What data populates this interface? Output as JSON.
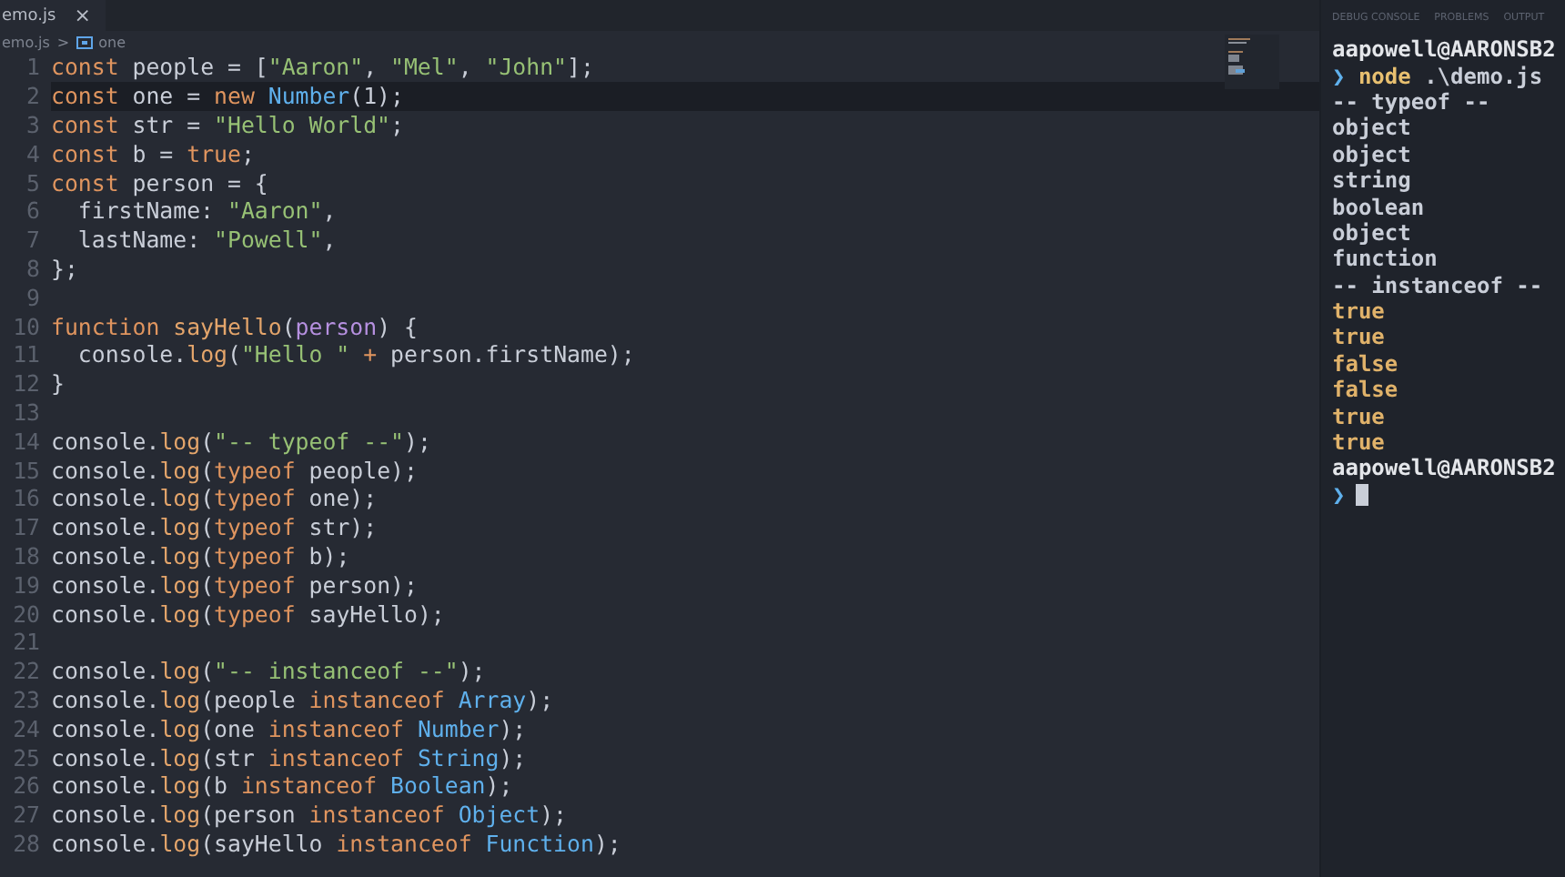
{
  "editor": {
    "tab": {
      "label": "emo.js",
      "close": "×"
    },
    "breadcrumb": {
      "file": "emo.js",
      "separator": ">",
      "symbol": "one"
    },
    "lines": [
      {
        "number": "1",
        "selected": false,
        "tokens": [
          {
            "kind": "keyword",
            "text": "const "
          },
          {
            "kind": "plain",
            "text": "people = ["
          },
          {
            "kind": "string",
            "text": "\"Aaron\""
          },
          {
            "kind": "plain",
            "text": ", "
          },
          {
            "kind": "string",
            "text": "\"Mel\""
          },
          {
            "kind": "plain",
            "text": ", "
          },
          {
            "kind": "string",
            "text": "\"John\""
          },
          {
            "kind": "plain",
            "text": "];"
          }
        ]
      },
      {
        "number": "2",
        "selected": true,
        "tokens": [
          {
            "kind": "keyword",
            "text": "const "
          },
          {
            "kind": "plain",
            "text": "one = "
          },
          {
            "kind": "keyword",
            "text": "new "
          },
          {
            "kind": "type",
            "text": "Number"
          },
          {
            "kind": "plain",
            "text": "(1);"
          }
        ]
      },
      {
        "number": "3",
        "selected": false,
        "tokens": [
          {
            "kind": "keyword",
            "text": "const "
          },
          {
            "kind": "plain",
            "text": "str = "
          },
          {
            "kind": "string",
            "text": "\"Hello World\""
          },
          {
            "kind": "plain",
            "text": ";"
          }
        ]
      },
      {
        "number": "4",
        "selected": false,
        "tokens": [
          {
            "kind": "keyword",
            "text": "const "
          },
          {
            "kind": "plain",
            "text": "b = "
          },
          {
            "kind": "keyword",
            "text": "true"
          },
          {
            "kind": "plain",
            "text": ";"
          }
        ]
      },
      {
        "number": "5",
        "selected": false,
        "tokens": [
          {
            "kind": "keyword",
            "text": "const "
          },
          {
            "kind": "plain",
            "text": "person = {"
          }
        ]
      },
      {
        "number": "6",
        "selected": false,
        "tokens": [
          {
            "kind": "plain",
            "text": "  firstName: "
          },
          {
            "kind": "string",
            "text": "\"Aaron\""
          },
          {
            "kind": "plain",
            "text": ","
          }
        ]
      },
      {
        "number": "7",
        "selected": false,
        "tokens": [
          {
            "kind": "plain",
            "text": "  lastName: "
          },
          {
            "kind": "string",
            "text": "\"Powell\""
          },
          {
            "kind": "plain",
            "text": ","
          }
        ]
      },
      {
        "number": "8",
        "selected": false,
        "tokens": [
          {
            "kind": "plain",
            "text": "};"
          }
        ]
      },
      {
        "number": "9",
        "selected": false
      },
      {
        "number": "10",
        "selected": false,
        "tokens": [
          {
            "kind": "keyword",
            "text": "function "
          },
          {
            "kind": "method",
            "text": "sayHello"
          },
          {
            "kind": "plain",
            "text": "("
          },
          {
            "kind": "param",
            "text": "person"
          },
          {
            "kind": "plain",
            "text": ") {"
          }
        ]
      },
      {
        "number": "11",
        "selected": false,
        "tokens": [
          {
            "kind": "plain",
            "text": "  console."
          },
          {
            "kind": "method",
            "text": "log"
          },
          {
            "kind": "plain",
            "text": "("
          },
          {
            "kind": "string",
            "text": "\"Hello \""
          },
          {
            "kind": "keyword",
            "text": " + "
          },
          {
            "kind": "plain",
            "text": "person.firstName);"
          }
        ]
      },
      {
        "number": "12",
        "selected": false,
        "tokens": [
          {
            "kind": "plain",
            "text": "}"
          }
        ]
      },
      {
        "number": "13",
        "selected": false
      },
      {
        "number": "14",
        "selected": false,
        "tokens": [
          {
            "kind": "plain",
            "text": "console."
          },
          {
            "kind": "method",
            "text": "log"
          },
          {
            "kind": "plain",
            "text": "("
          },
          {
            "kind": "string",
            "text": "\"-- typeof --\""
          },
          {
            "kind": "plain",
            "text": ");"
          }
        ]
      },
      {
        "number": "15",
        "selected": false,
        "tokens": [
          {
            "kind": "plain",
            "text": "console."
          },
          {
            "kind": "method",
            "text": "log"
          },
          {
            "kind": "plain",
            "text": "("
          },
          {
            "kind": "keyword",
            "text": "typeof"
          },
          {
            "kind": "plain",
            "text": " people);"
          }
        ]
      },
      {
        "number": "16",
        "selected": false,
        "tokens": [
          {
            "kind": "plain",
            "text": "console."
          },
          {
            "kind": "method",
            "text": "log"
          },
          {
            "kind": "plain",
            "text": "("
          },
          {
            "kind": "keyword",
            "text": "typeof"
          },
          {
            "kind": "plain",
            "text": " one);"
          }
        ]
      },
      {
        "number": "17",
        "selected": false,
        "tokens": [
          {
            "kind": "plain",
            "text": "console."
          },
          {
            "kind": "method",
            "text": "log"
          },
          {
            "kind": "plain",
            "text": "("
          },
          {
            "kind": "keyword",
            "text": "typeof"
          },
          {
            "kind": "plain",
            "text": " str);"
          }
        ]
      },
      {
        "number": "18",
        "selected": false,
        "tokens": [
          {
            "kind": "plain",
            "text": "console."
          },
          {
            "kind": "method",
            "text": "log"
          },
          {
            "kind": "plain",
            "text": "("
          },
          {
            "kind": "keyword",
            "text": "typeof"
          },
          {
            "kind": "plain",
            "text": " b);"
          }
        ]
      },
      {
        "number": "19",
        "selected": false,
        "tokens": [
          {
            "kind": "plain",
            "text": "console."
          },
          {
            "kind": "method",
            "text": "log"
          },
          {
            "kind": "plain",
            "text": "("
          },
          {
            "kind": "keyword",
            "text": "typeof"
          },
          {
            "kind": "plain",
            "text": " person);"
          }
        ]
      },
      {
        "number": "20",
        "selected": false,
        "tokens": [
          {
            "kind": "plain",
            "text": "console."
          },
          {
            "kind": "method",
            "text": "log"
          },
          {
            "kind": "plain",
            "text": "("
          },
          {
            "kind": "keyword",
            "text": "typeof"
          },
          {
            "kind": "plain",
            "text": " sayHello);"
          }
        ]
      },
      {
        "number": "21",
        "selected": false
      },
      {
        "number": "22",
        "selected": false,
        "tokens": [
          {
            "kind": "plain",
            "text": "console."
          },
          {
            "kind": "method",
            "text": "log"
          },
          {
            "kind": "plain",
            "text": "("
          },
          {
            "kind": "string",
            "text": "\"-- instanceof --\""
          },
          {
            "kind": "plain",
            "text": ");"
          }
        ]
      },
      {
        "number": "23",
        "selected": false,
        "tokens": [
          {
            "kind": "plain",
            "text": "console."
          },
          {
            "kind": "method",
            "text": "log"
          },
          {
            "kind": "plain",
            "text": "(people "
          },
          {
            "kind": "keyword",
            "text": "instanceof"
          },
          {
            "kind": "type",
            "text": " Array"
          },
          {
            "kind": "plain",
            "text": ");"
          }
        ]
      },
      {
        "number": "24",
        "selected": false,
        "tokens": [
          {
            "kind": "plain",
            "text": "console."
          },
          {
            "kind": "method",
            "text": "log"
          },
          {
            "kind": "plain",
            "text": "(one "
          },
          {
            "kind": "keyword",
            "text": "instanceof"
          },
          {
            "kind": "type",
            "text": " Number"
          },
          {
            "kind": "plain",
            "text": ");"
          }
        ]
      },
      {
        "number": "25",
        "selected": false,
        "tokens": [
          {
            "kind": "plain",
            "text": "console."
          },
          {
            "kind": "method",
            "text": "log"
          },
          {
            "kind": "plain",
            "text": "(str "
          },
          {
            "kind": "keyword",
            "text": "instanceof"
          },
          {
            "kind": "type",
            "text": " String"
          },
          {
            "kind": "plain",
            "text": ");"
          }
        ]
      },
      {
        "number": "26",
        "selected": false,
        "tokens": [
          {
            "kind": "plain",
            "text": "console."
          },
          {
            "kind": "method",
            "text": "log"
          },
          {
            "kind": "plain",
            "text": "(b "
          },
          {
            "kind": "keyword",
            "text": "instanceof"
          },
          {
            "kind": "type",
            "text": " Boolean"
          },
          {
            "kind": "plain",
            "text": ");"
          }
        ]
      },
      {
        "number": "27",
        "selected": false,
        "tokens": [
          {
            "kind": "plain",
            "text": "console."
          },
          {
            "kind": "method",
            "text": "log"
          },
          {
            "kind": "plain",
            "text": "(person "
          },
          {
            "kind": "keyword",
            "text": "instanceof"
          },
          {
            "kind": "type",
            "text": " Object"
          },
          {
            "kind": "plain",
            "text": ");"
          }
        ]
      },
      {
        "number": "28",
        "selected": false,
        "tokens": [
          {
            "kind": "plain",
            "text": "console."
          },
          {
            "kind": "method",
            "text": "log"
          },
          {
            "kind": "plain",
            "text": "(sayHello "
          },
          {
            "kind": "keyword",
            "text": "instanceof"
          },
          {
            "kind": "type",
            "text": " Function"
          },
          {
            "kind": "plain",
            "text": ");"
          }
        ]
      }
    ]
  },
  "panel": {
    "tabs": [
      {
        "label": "DEBUG CONSOLE",
        "selected": false
      },
      {
        "label": "PROBLEMS",
        "selected": false
      },
      {
        "label": "OUTPUT",
        "selected": false
      }
    ],
    "terminal": [
      {
        "kind": "user",
        "text": "aapowell@AARONSB2"
      },
      {
        "kind": "command",
        "prompt": "❯",
        "command": "node",
        "args": " .\\demo.js"
      },
      {
        "kind": "output",
        "text": "-- typeof --"
      },
      {
        "kind": "output",
        "text": "object"
      },
      {
        "kind": "output",
        "text": "object"
      },
      {
        "kind": "output",
        "text": "string"
      },
      {
        "kind": "output",
        "text": "boolean"
      },
      {
        "kind": "output",
        "text": "object"
      },
      {
        "kind": "output",
        "text": "function"
      },
      {
        "kind": "output",
        "text": "-- instanceof --"
      },
      {
        "kind": "value",
        "text": "true"
      },
      {
        "kind": "value",
        "text": "true"
      },
      {
        "kind": "value",
        "text": "false"
      },
      {
        "kind": "value",
        "text": "false"
      },
      {
        "kind": "value",
        "text": "true"
      },
      {
        "kind": "value",
        "text": "true"
      },
      {
        "kind": "user",
        "text": "aapowell@AARONSB2"
      },
      {
        "kind": "input",
        "prompt": "❯"
      }
    ]
  }
}
